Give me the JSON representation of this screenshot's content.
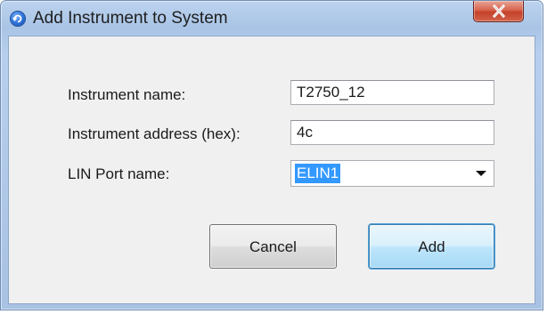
{
  "window": {
    "title": "Add Instrument to System",
    "app_icon": "refresh-app-icon",
    "close_icon": "close-icon"
  },
  "form": {
    "instrument_name_label": "Instrument name:",
    "instrument_name_value": "T2750_12",
    "instrument_address_label": "Instrument address (hex):",
    "instrument_address_value": "4c",
    "lin_port_label": "LIN Port name:",
    "lin_port_value": "ELIN1",
    "dropdown_icon": "chevron-down-icon"
  },
  "buttons": {
    "cancel_label": "Cancel",
    "add_label": "Add"
  },
  "colors": {
    "selection_highlight": "#3399ff",
    "close_button": "#c4412a",
    "default_button_border": "#3c7fb1"
  }
}
